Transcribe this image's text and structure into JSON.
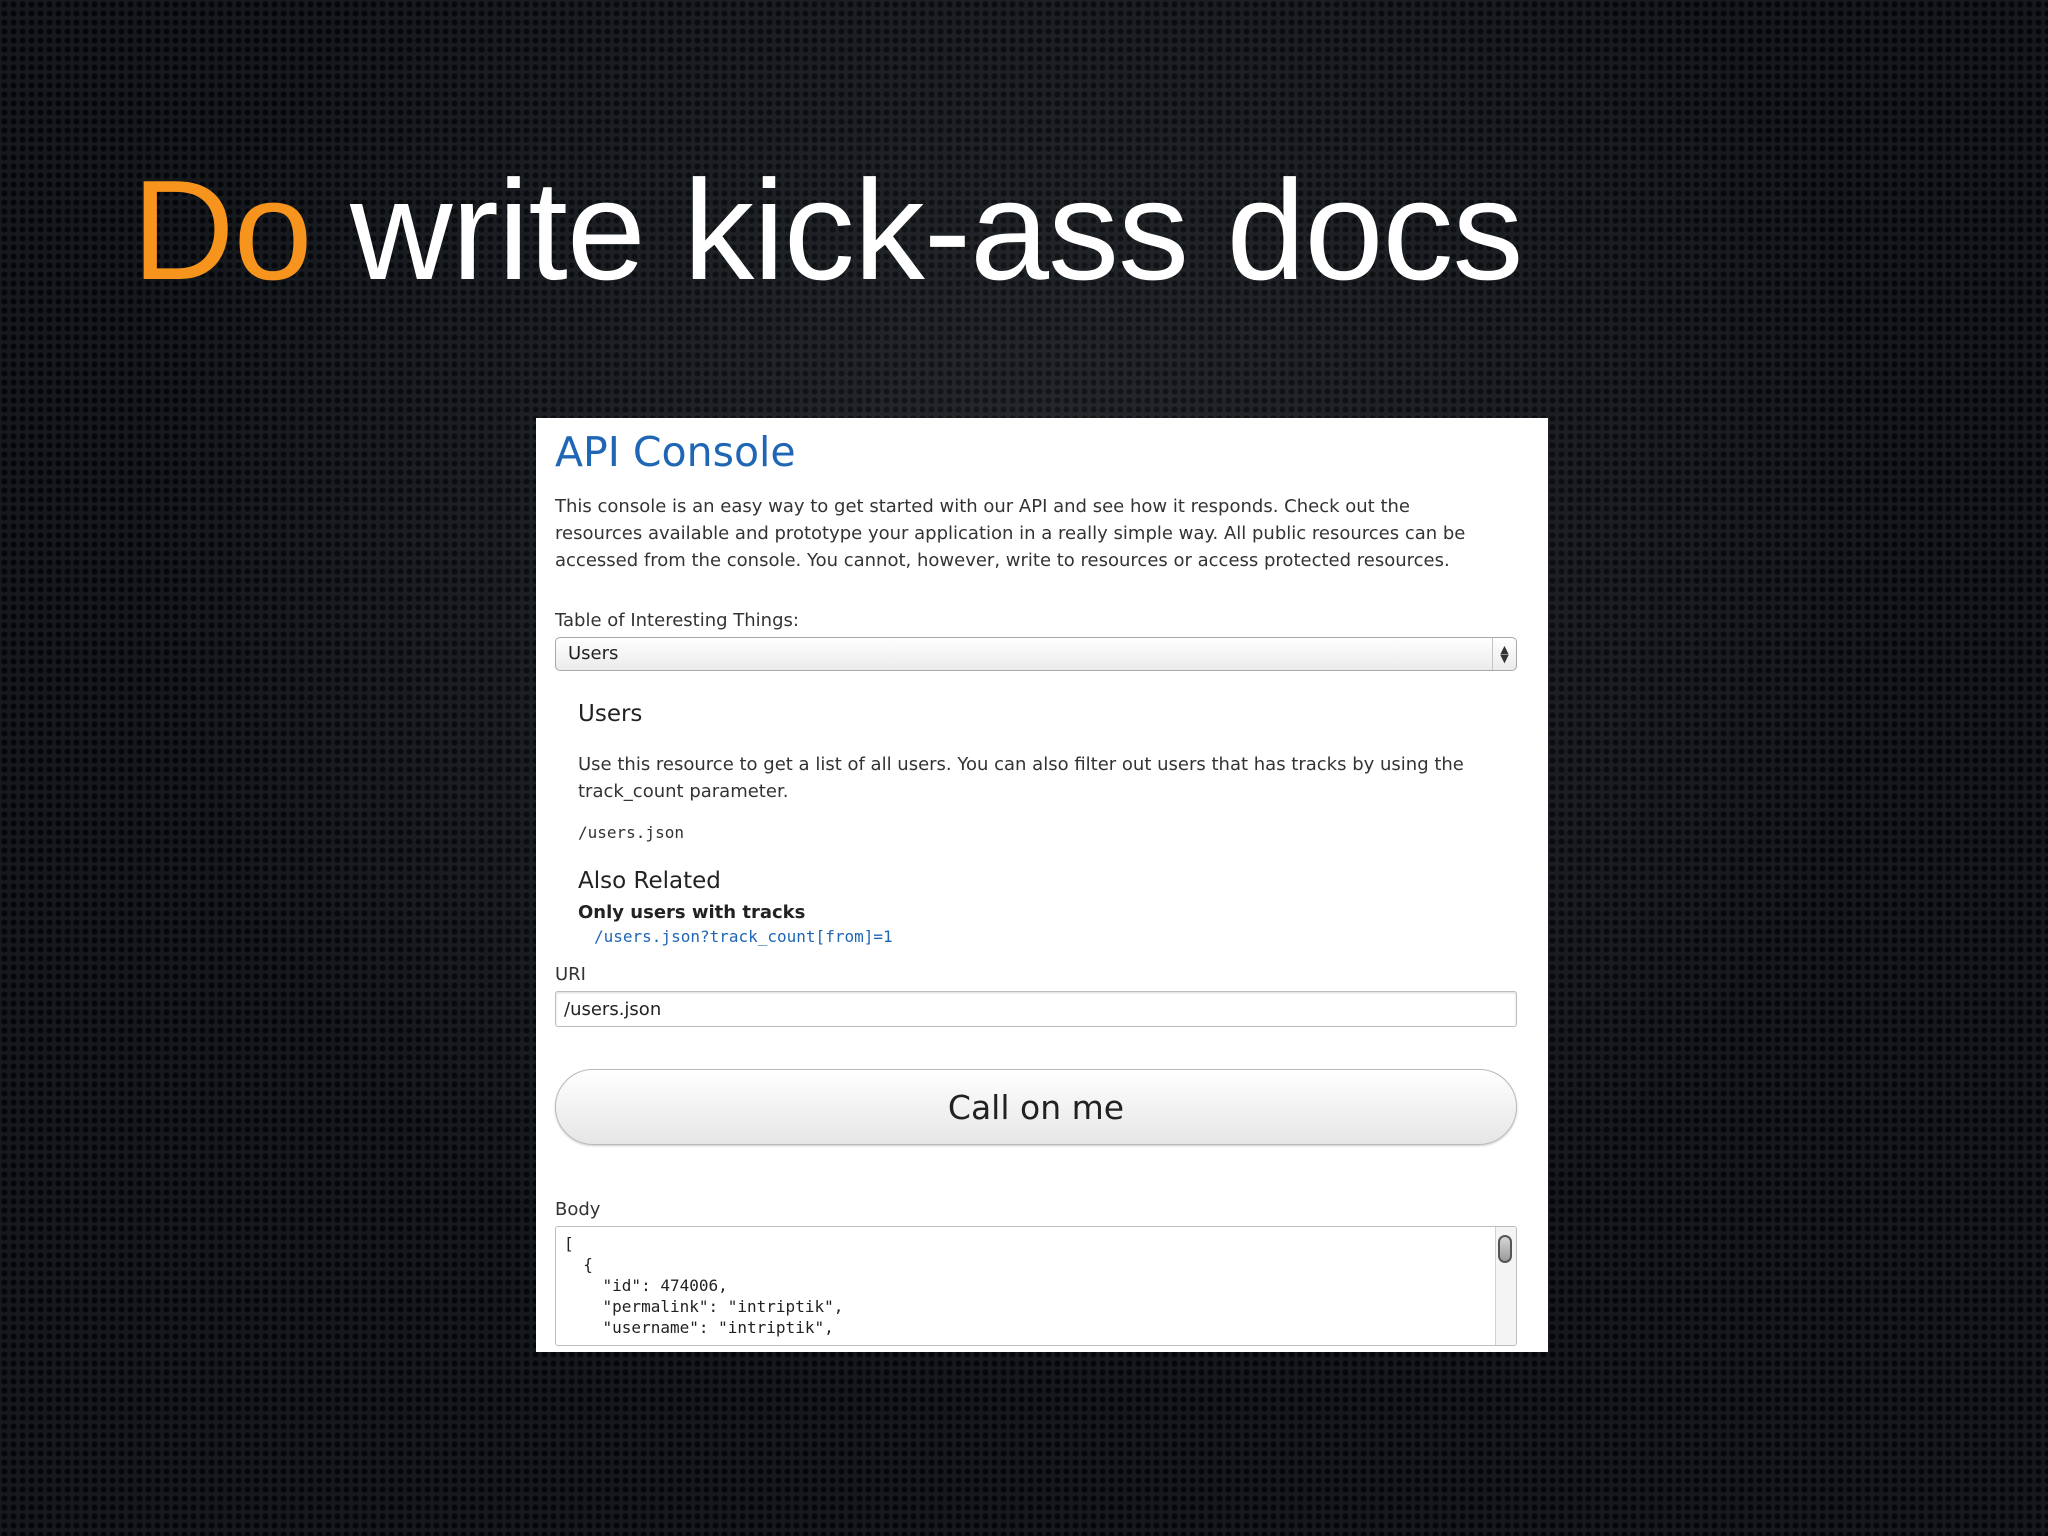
{
  "slide": {
    "title_accent": "Do",
    "title_rest": " write kick-ass docs",
    "accent_color": "#f7941d"
  },
  "console": {
    "title": "API Console",
    "intro": "This console is an easy way to get started with our API and see how it responds. Check out the resources available and prototype your application in a really simple way. All public resources can be accessed from the console. You cannot, however, write to resources or access protected resources.",
    "table_label": "Table of Interesting Things:",
    "table_selected": "Users",
    "resource": {
      "heading": "Users",
      "description": "Use this resource to get a list of all users. You can also filter out users that has tracks by using the track_count parameter.",
      "path": "/users.json"
    },
    "related": {
      "heading": "Also Related",
      "title": "Only users with tracks",
      "link": "/users.json?track_count[from]=1"
    },
    "uri_label": "URI",
    "uri_value": "/users.json",
    "call_button": "Call on me",
    "body_label": "Body",
    "body_text": "[\n  {\n    \"id\": 474006,\n    \"permalink\": \"intriptik\",\n    \"username\": \"intriptik\","
  }
}
